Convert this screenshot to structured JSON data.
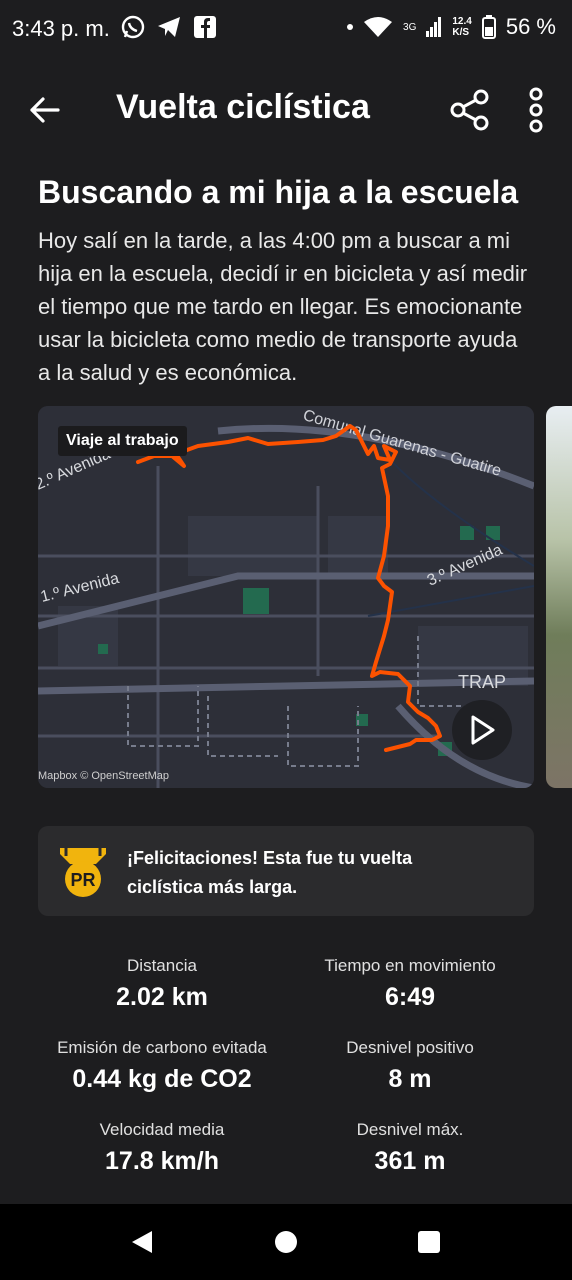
{
  "status_bar": {
    "time": "3:43 p. m.",
    "network_type": "3G",
    "speed_value": "12.4",
    "speed_unit": "K/S",
    "battery": "56 %"
  },
  "header": {
    "title": "Vuelta ciclística"
  },
  "activity": {
    "title": "Buscando a mi hija a la escuela",
    "description": "Hoy salí en la tarde, a las 4:00 pm a buscar a mi hija en la escuela, decidí ir en bicicleta y así medir el tiempo que me tardo en llegar. Es emocionante usar la bicicleta como medio de transporte ayuda a la salud y es económica."
  },
  "map": {
    "tag": "Viaje al trabajo",
    "credit": "Mapbox © OpenStreetMap",
    "street_labels": [
      "Comunal Guarenas - Guatire",
      "1.º Avenida",
      "3.º Avenida",
      "TRAP",
      "2.º Avenida"
    ],
    "route_color": "#fc5200"
  },
  "achievement": {
    "badge_text": "PR",
    "message": "¡Felicitaciones! Esta fue tu vuelta ciclística más larga.",
    "badge_color": "#f1b40d"
  },
  "stats": [
    {
      "label": "Distancia",
      "value": "2.02 km"
    },
    {
      "label": "Tiempo en movimiento",
      "value": "6:49"
    },
    {
      "label": "Emisión de carbono evitada",
      "value": "0.44 kg de CO2"
    },
    {
      "label": "Desnivel positivo",
      "value": "8 m"
    },
    {
      "label": "Velocidad media",
      "value": "17.8 km/h"
    },
    {
      "label": "Desnivel máx.",
      "value": "361 m"
    }
  ]
}
